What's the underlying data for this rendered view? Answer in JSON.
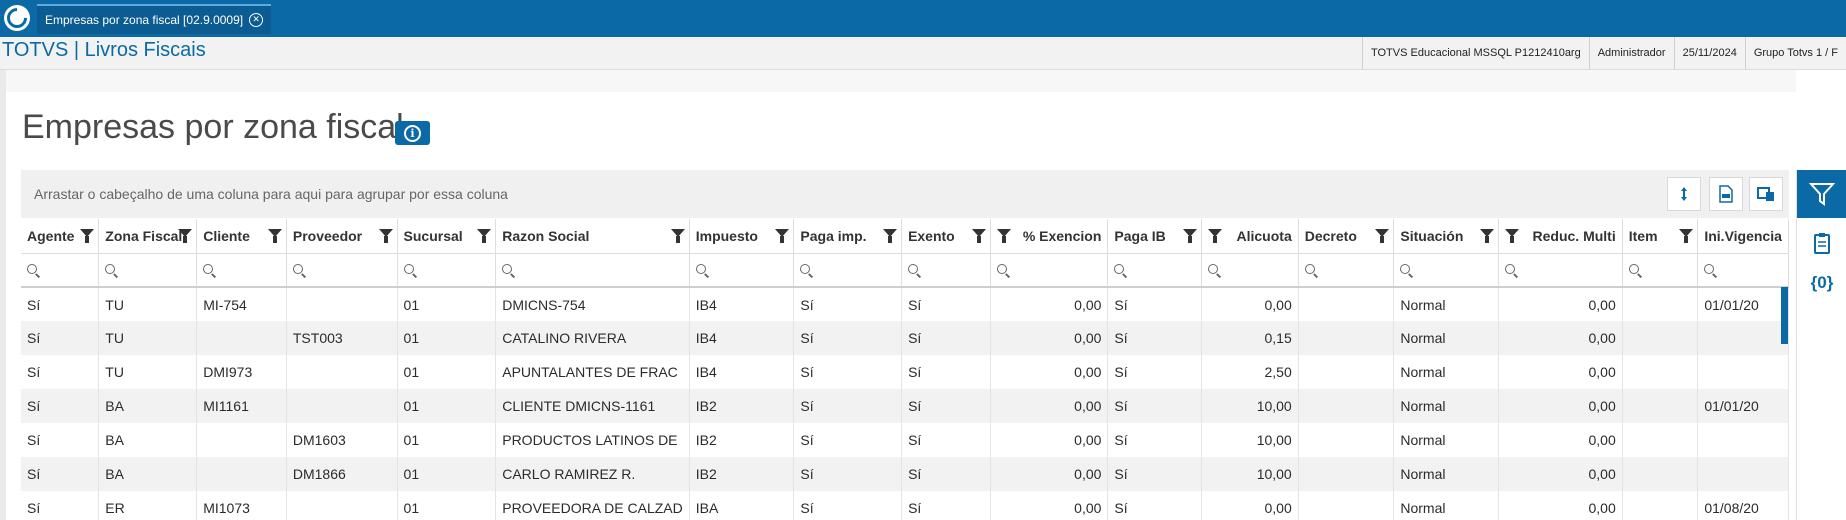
{
  "tabbar": {
    "tab_title": "Empresas por zona fiscal [02.9.0009]",
    "close_icon": "close-circle-icon"
  },
  "header": {
    "brand": "TOTVS | Livros Fiscais",
    "environment": "TOTVS Educacional MSSQL P1212410arg",
    "user": "Administrador",
    "date": "25/11/2024",
    "company": "Grupo Totvs 1 / F"
  },
  "page": {
    "title": "Empresas por zona fiscal",
    "group_hint": "Arrastar o cabeçalho de uma coluna para aqui para agrupar por essa coluna"
  },
  "grid": {
    "columns": [
      {
        "label": "Agente",
        "align": "left",
        "width": 78
      },
      {
        "label": "Zona Fiscal",
        "align": "left",
        "width": 98
      },
      {
        "label": "Cliente",
        "align": "left",
        "width": 90
      },
      {
        "label": "Proveedor",
        "align": "left",
        "width": 111
      },
      {
        "label": "Sucursal",
        "align": "left",
        "width": 99
      },
      {
        "label": "Razon Social",
        "align": "left",
        "width": 178
      },
      {
        "label": "Impuesto",
        "align": "left",
        "width": 105
      },
      {
        "label": "Paga imp.",
        "align": "left",
        "width": 108
      },
      {
        "label": "Exento",
        "align": "left",
        "width": 89
      },
      {
        "label": "% Exencion",
        "align": "right",
        "width": 118
      },
      {
        "label": "Paga IB",
        "align": "left",
        "width": 94
      },
      {
        "label": "Alicuota",
        "align": "right",
        "width": 97
      },
      {
        "label": "Decreto",
        "align": "left",
        "width": 96
      },
      {
        "label": "Situación",
        "align": "left",
        "width": 105
      },
      {
        "label": "Reduc. Multi",
        "align": "right",
        "width": 124
      },
      {
        "label": "Item",
        "align": "left",
        "width": 76
      },
      {
        "label": "Ini.Vigencia",
        "align": "left",
        "width": 70
      }
    ],
    "rows": [
      [
        "Sí",
        "TU",
        "MI-754",
        "",
        "01",
        "DMICNS-754",
        "IB4",
        "Sí",
        "Sí",
        "0,00",
        "Sí",
        "0,00",
        "",
        "Normal",
        "0,00",
        "",
        "01/01/20"
      ],
      [
        "Sí",
        "TU",
        "",
        "TST003",
        "01",
        "CATALINO RIVERA",
        "IB4",
        "Sí",
        "Sí",
        "0,00",
        "Sí",
        "0,15",
        "",
        "Normal",
        "0,00",
        "",
        ""
      ],
      [
        "Sí",
        "TU",
        "DMI973",
        "",
        "01",
        "APUNTALANTES DE FRAC",
        "IB4",
        "Sí",
        "Sí",
        "0,00",
        "Sí",
        "2,50",
        "",
        "Normal",
        "0,00",
        "",
        ""
      ],
      [
        "Sí",
        "BA",
        "MI1161",
        "",
        "01",
        "CLIENTE DMICNS-1161",
        "IB2",
        "Sí",
        "Sí",
        "0,00",
        "Sí",
        "10,00",
        "",
        "Normal",
        "0,00",
        "",
        "01/01/20"
      ],
      [
        "Sí",
        "BA",
        "",
        "DM1603",
        "01",
        "PRODUCTOS LATINOS DE",
        "IB2",
        "Sí",
        "Sí",
        "0,00",
        "Sí",
        "10,00",
        "",
        "Normal",
        "0,00",
        "",
        ""
      ],
      [
        "Sí",
        "BA",
        "",
        "DM1866",
        "01",
        "CARLO RAMIREZ R.",
        "IB2",
        "Sí",
        "Sí",
        "0,00",
        "Sí",
        "10,00",
        "",
        "Normal",
        "0,00",
        "",
        ""
      ],
      [
        "Sí",
        "ER",
        "MI1073",
        "",
        "01",
        "PROVEEDORA DE CALZAD",
        "IBA",
        "Sí",
        "Sí",
        "0,00",
        "Sí",
        "0,00",
        "",
        "Normal",
        "0,00",
        "",
        "01/08/20"
      ]
    ]
  },
  "toolbar": {
    "icons": [
      "expand-rows-icon",
      "export-xlsx-icon",
      "columns-config-icon"
    ]
  },
  "right_panel": {
    "icons": [
      "filter-icon",
      "clipboard-icon",
      "variables-icon"
    ],
    "variables_glyph": "{0}"
  },
  "colors": {
    "primary": "#0b6aa6",
    "alt_row": "#f2f2f2"
  }
}
